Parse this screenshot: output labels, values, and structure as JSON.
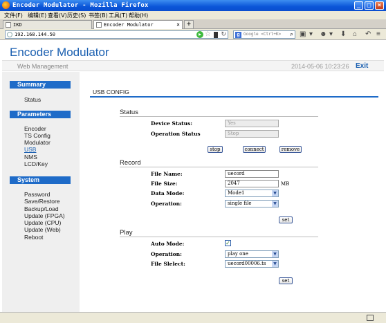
{
  "window": {
    "title": "Encoder Modulator - Mozilla Firefox"
  },
  "menubar": {
    "items": [
      "文件(F)",
      "编辑(E)",
      "查看(V)",
      "历史(S)",
      "书签(B)",
      "工具(T)",
      "帮助(H)"
    ]
  },
  "tabs": [
    {
      "label": "IKD"
    },
    {
      "label": "Encoder Modulator"
    }
  ],
  "navbar": {
    "url": "192.168.144.50",
    "search_placeholder": "Google <Ctrl+K>"
  },
  "header": {
    "brand": "Encoder Modulator",
    "subtitle": "Web Management",
    "datetime": "2014-05-06 10:23:26",
    "exit": "Exit"
  },
  "sidebar": {
    "summary": {
      "title": "Summary",
      "items": [
        "Status"
      ]
    },
    "parameters": {
      "title": "Parameters",
      "items": [
        "Encoder",
        "TS Config",
        "Modulator",
        "USB",
        "NMS",
        "LCD/Key"
      ]
    },
    "system": {
      "title": "System",
      "items": [
        "Password",
        "Save/Restore",
        "Backup/Load",
        "Update (FPGA)",
        "Update (CPU)",
        "Update (Web)",
        "Reboot"
      ]
    }
  },
  "main": {
    "title": "USB CONFIG",
    "status": {
      "title": "Status",
      "device_status_label": "Device Status:",
      "device_status_value": "Yes",
      "operation_status_label": "Operation Status",
      "operation_status_value": "Stop",
      "stop": "stop",
      "connect": "connect",
      "remove": "remove"
    },
    "record": {
      "title": "Record",
      "file_name_label": "File Name:",
      "file_name_value": "uecord",
      "file_size_label": "File Size:",
      "file_size_value": "2047",
      "file_size_unit": "MB",
      "data_mode_label": "Data Mode:",
      "data_mode_value": "Mode1",
      "operation_label": "Operation:",
      "operation_value": "single file",
      "set": "set"
    },
    "play": {
      "title": "Play",
      "auto_mode_label": "Auto Mode:",
      "auto_mode_checked": true,
      "operation_label": "Operation:",
      "operation_value": "play one",
      "file_select_label": "File Slelect:",
      "file_select_value": "uecord00006.ts",
      "set": "set"
    }
  },
  "colors": {
    "accent": "#1e6bc8",
    "brand": "#1a5fb0",
    "sidebar_bg": "#efefef"
  }
}
